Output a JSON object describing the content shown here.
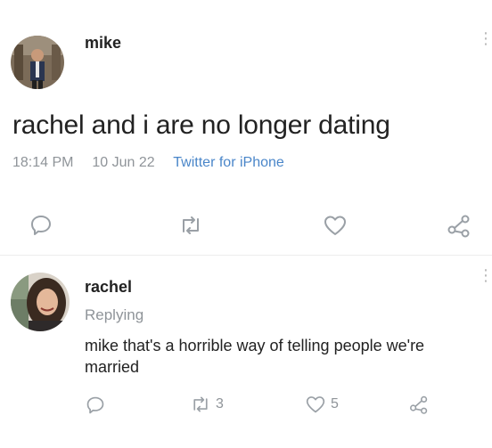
{
  "tweet": {
    "username": "mike",
    "text": "rachel and i are no longer dating",
    "time": "18:14 PM",
    "date": "10 Jun 22",
    "source": "Twitter for iPhone"
  },
  "reply": {
    "username": "rachel",
    "status": "Replying",
    "text_line1": "mike that's a horrible way of telling people we're",
    "text_line2": "married",
    "retweet_count": "3",
    "like_count": "5"
  },
  "icons": [
    "reply-icon",
    "retweet-icon",
    "like-icon",
    "share-icon",
    "more-icon"
  ],
  "colors": {
    "link": "#4a86c9",
    "muted": "#8f9499",
    "icon": "#9aa0a6"
  }
}
